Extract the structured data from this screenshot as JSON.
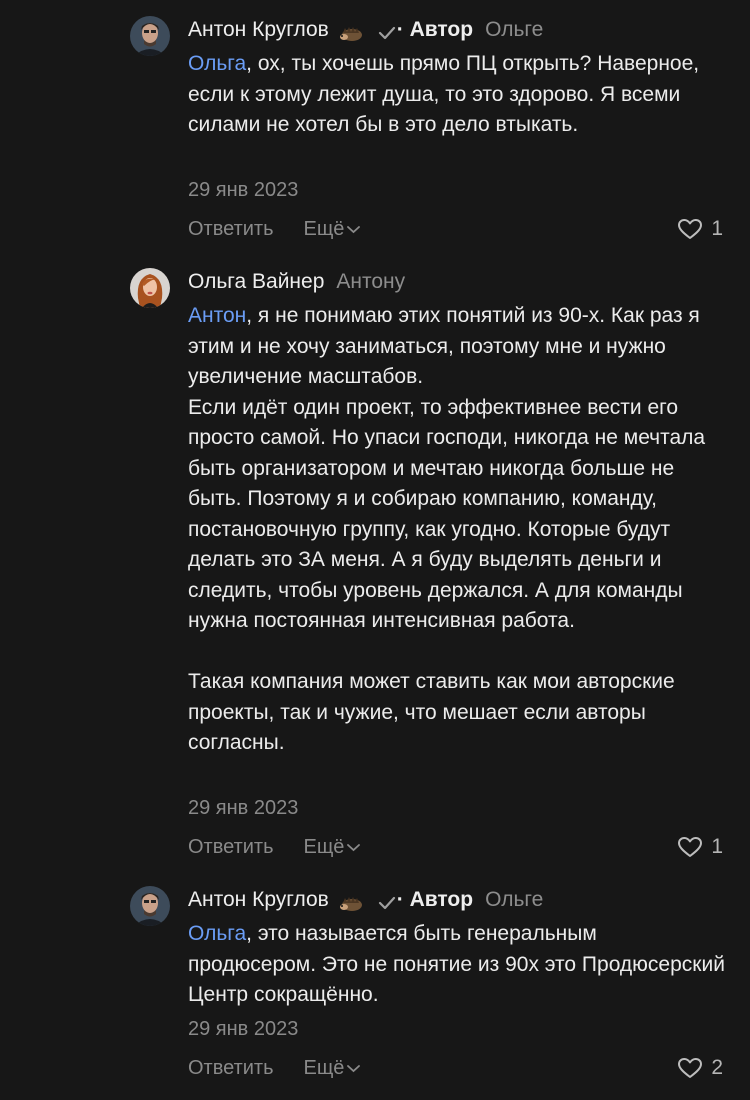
{
  "comments": [
    {
      "author": "Антон Круглов",
      "has_badge_icon": "hedgehog-emoji",
      "badge": "· Автор",
      "reply_to": "Ольге",
      "mention": "Ольга",
      "text": ", ох, ты хочешь прямо ПЦ открыть? Наверное, если к этому лежит душа, то это здорово. Я всеми силами не хотел бы в это дело втыкать.",
      "date": "29 янв 2023",
      "reply_label": "Ответить",
      "more_label": "Ещё",
      "likes": "1"
    },
    {
      "author": "Ольга Вайнер",
      "reply_to": "Антону",
      "mention": "Антон",
      "text": ", я не понимаю этих понятий из 90-х. Как раз я этим и не хочу заниматься, поэтому мне и нужно увеличение масштабов.\nЕсли идёт один проект, то эффективнее вести его просто самой. Но упаси господи, никогда не мечтала быть организатором и мечтаю никогда больше не быть. Поэтому я и собираю компанию, команду, постановочную группу, как угодно. Которые будут делать это ЗА меня. А я буду выделять деньги и следить, чтобы уровень держался. А для команды нужна постоянная интенсивная работа.\n\nТакая компания может ставить как мои авторские проекты, так и чужие, что мешает если авторы согласны.",
      "date": "29 янв 2023",
      "reply_label": "Ответить",
      "more_label": "Ещё",
      "likes": "1"
    },
    {
      "author": "Антон Круглов",
      "has_badge_icon": "hedgehog-emoji",
      "badge": "· Автор",
      "reply_to": "Ольге",
      "mention": "Ольга",
      "text": ", это называется быть генеральным продюсером. Это не понятие из 90х это Продюсерский Центр сокращённо.",
      "date": "29 янв 2023",
      "reply_label": "Ответить",
      "more_label": "Ещё",
      "likes": "2"
    }
  ],
  "colors": {
    "background": "#171717",
    "mention": "#6b9df5",
    "muted": "#8a8a8a",
    "text": "#ececec"
  }
}
